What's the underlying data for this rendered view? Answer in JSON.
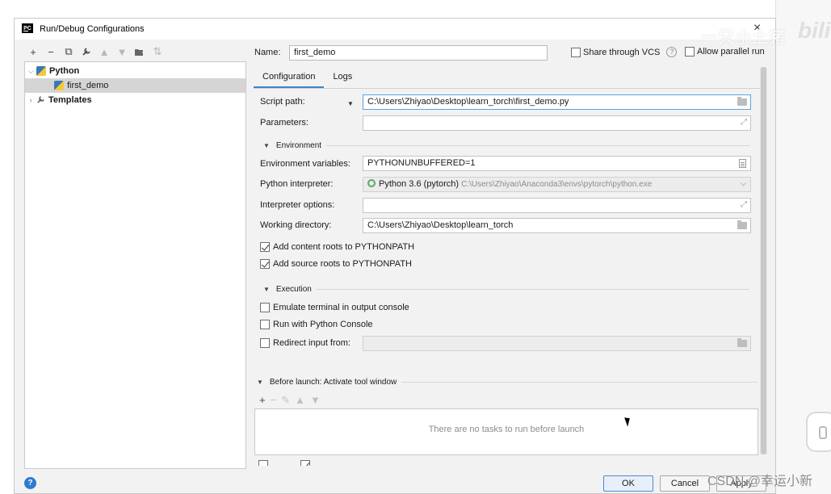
{
  "dialog": {
    "title": "Run/Debug Configurations",
    "title_icon": "pycharm-icon",
    "close_label": "×"
  },
  "left_toolbar": {
    "add": "+",
    "remove": "−",
    "copy": "⧉",
    "edit_templates": "🔧",
    "move_up": "▲",
    "move_down": "▼",
    "new_folder": "📁",
    "sort": "⇅"
  },
  "tree": {
    "items": [
      {
        "label": "Python",
        "arrow": "⌵"
      },
      {
        "label": "first_demo"
      },
      {
        "label": "Templates",
        "arrow": "›"
      }
    ]
  },
  "name": {
    "label": "Name:",
    "value": "first_demo"
  },
  "options": {
    "share_vcs": "Share through VCS",
    "share_vcs_checked": false,
    "help": "?",
    "allow_parallel": "Allow parallel run",
    "allow_parallel_checked": false
  },
  "tabs": [
    {
      "label": "Configuration",
      "active": true
    },
    {
      "label": "Logs",
      "active": false
    }
  ],
  "form": {
    "script_path_label": "Script path:",
    "script_path_value": "C:\\Users\\Zhiyao\\Desktop\\learn_torch\\first_demo.py",
    "parameters_label": "Parameters:",
    "parameters_value": "",
    "environment_section": "Environment",
    "env_vars_label": "Environment variables:",
    "env_vars_value": "PYTHONUNBUFFERED=1",
    "interpreter_label": "Python interpreter:",
    "interpreter_name": "Python 3.6 (pytorch)",
    "interpreter_path": "C:\\Users\\Zhiyao\\Anaconda3\\envs\\pytorch\\python.exe",
    "interp_options_label": "Interpreter options:",
    "interp_options_value": "",
    "working_dir_label": "Working directory:",
    "working_dir_value": "C:\\Users\\Zhiyao\\Desktop\\learn_torch",
    "add_content_roots": "Add content roots to PYTHONPATH",
    "add_content_roots_checked": true,
    "add_source_roots": "Add source roots to PYTHONPATH",
    "add_source_roots_checked": true,
    "execution_section": "Execution",
    "emulate_terminal": "Emulate terminal in output console",
    "emulate_terminal_checked": false,
    "run_python_console": "Run with Python Console",
    "run_python_console_checked": false,
    "redirect_input": "Redirect input from:",
    "redirect_input_checked": false
  },
  "before_launch": {
    "section": "Before launch: Activate tool window",
    "add": "+",
    "remove": "−",
    "edit": "✎",
    "up": "▲",
    "down": "▼",
    "empty_text": "There are no tasks to run before launch"
  },
  "buttons": {
    "ok": "OK",
    "cancel": "Cancel",
    "apply": "Apply",
    "help": "?"
  },
  "watermarks": {
    "top": "一只小土猪",
    "bili": "bili",
    "csdn": "CSDN @幸运小新"
  },
  "colors": {
    "accent": "#4083c9",
    "python_blue": "#3b78b3",
    "python_yellow": "#f5c83b",
    "interpreter_green": "#59a869",
    "help_blue": "#2f7ad2"
  }
}
